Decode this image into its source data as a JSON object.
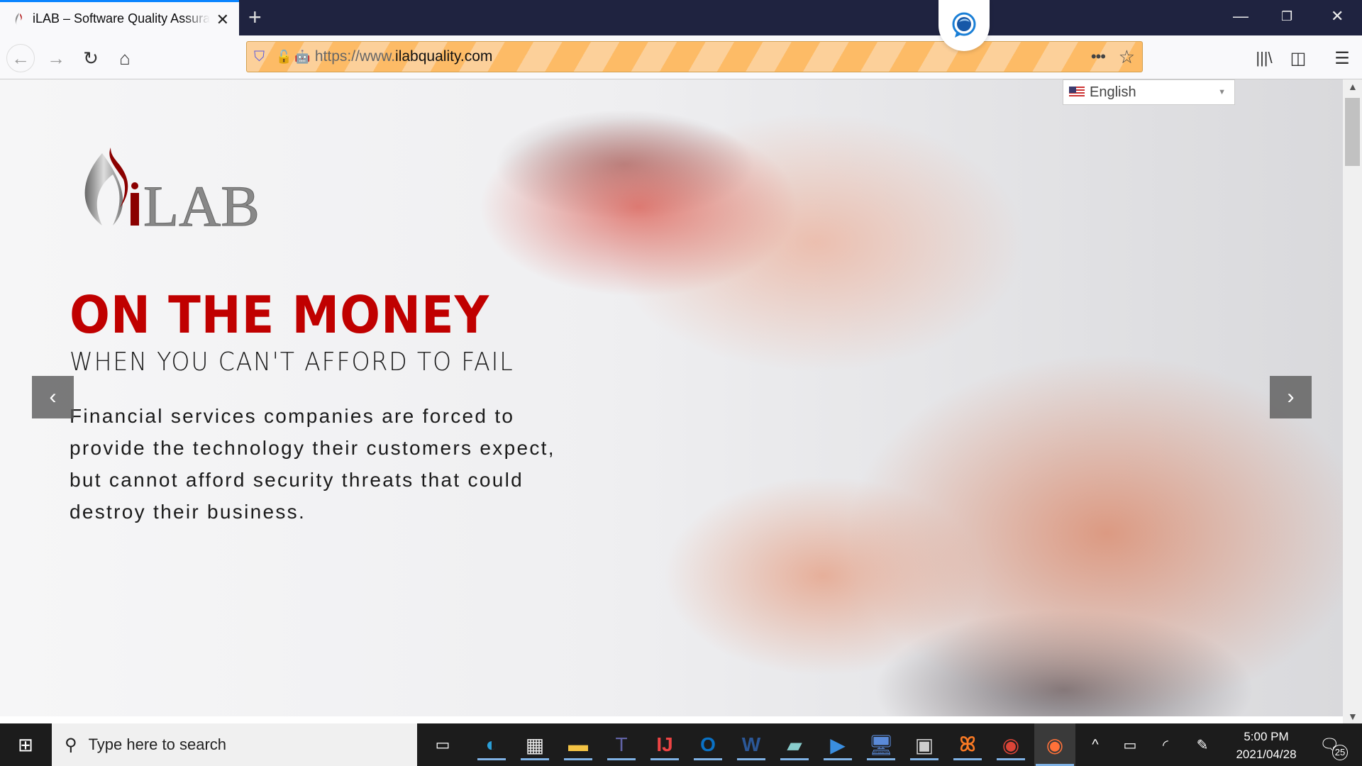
{
  "browser": {
    "tab_title": "iLAB – Software Quality Assurance",
    "url_prefix": "https://www.",
    "url_domain": "ilabquality.com",
    "icons": [
      "back-icon",
      "forward-icon",
      "reload-icon",
      "home-icon",
      "tracking-shield-icon",
      "insecure-lock-icon",
      "robot-icon",
      "page-actions-icon",
      "bookmark-star-icon",
      "library-icon",
      "sidebar-icon",
      "menu-icon"
    ]
  },
  "page": {
    "language": "English",
    "logo_text": "iLAB",
    "headline": "ON THE MONEY",
    "subheadline": "WHEN YOU CAN'T AFFORD TO FAIL",
    "body": "Financial services companies are forced to provide the technology their customers expect, but cannot afford security threats that could destroy their business.",
    "prev": "‹",
    "next": "›",
    "colors": {
      "headline": "#c00000",
      "text": "#1a1a1a"
    }
  },
  "taskbar": {
    "search_placeholder": "Type here to search",
    "time": "5:00 PM",
    "date": "2021/04/28",
    "notifications": "25",
    "apps": [
      "task-view",
      "edge",
      "store",
      "file-explorer",
      "teams",
      "intellij",
      "outlook",
      "word",
      "notepad",
      "media-player",
      "remote-desktop",
      "terminal",
      "xampp",
      "chrome",
      "firefox"
    ]
  }
}
